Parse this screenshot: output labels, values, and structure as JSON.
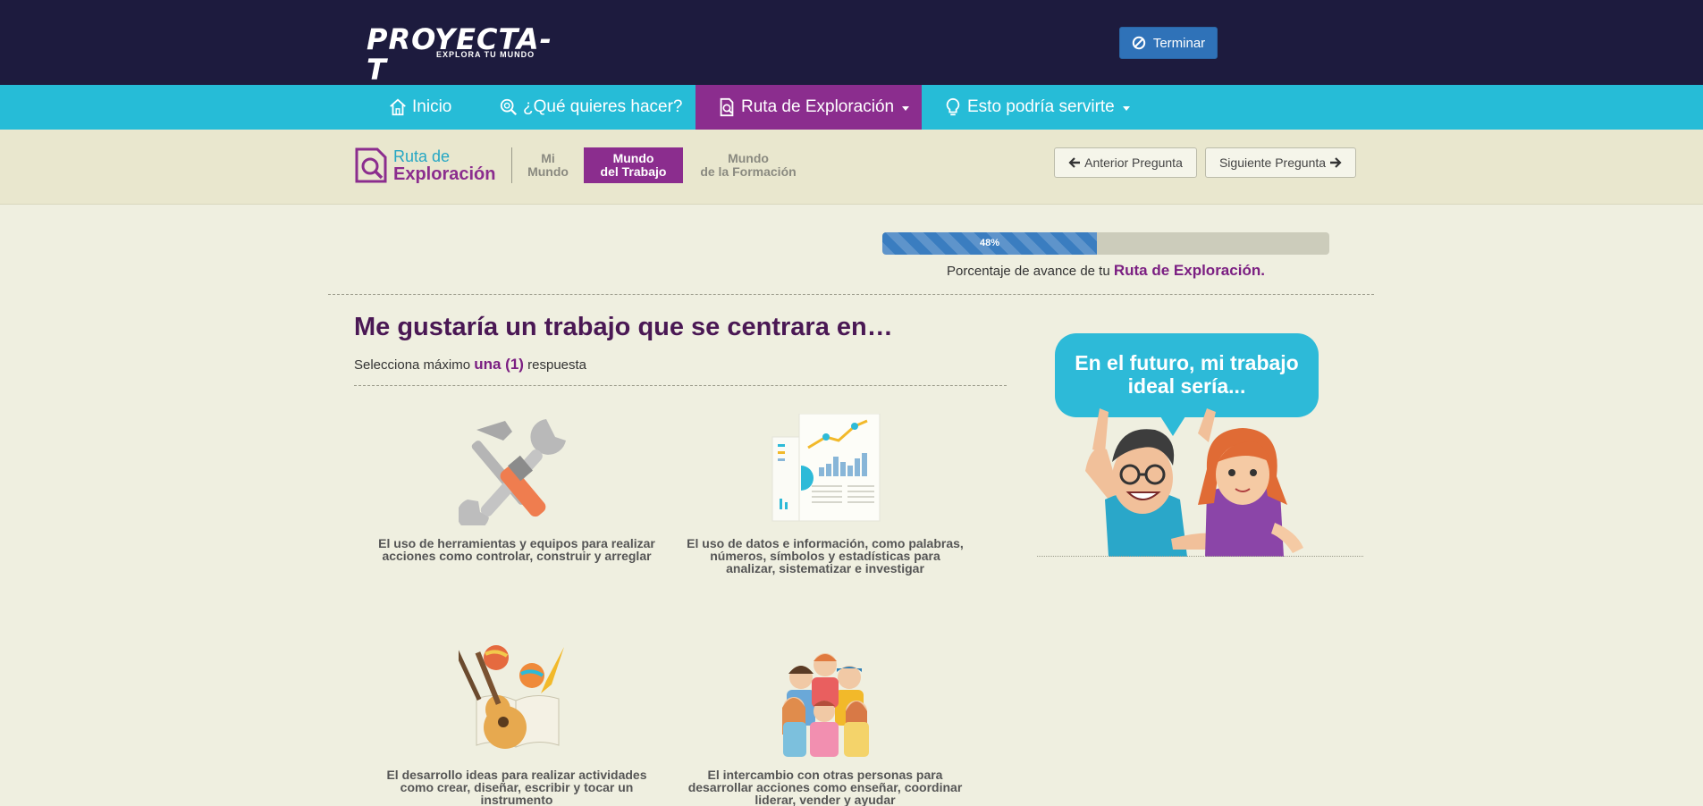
{
  "header": {
    "logo_main": "PROYECTA-T",
    "logo_sub": "EXPLORA TU MUNDO",
    "finish_label": "Terminar"
  },
  "nav": {
    "items": [
      {
        "label": "Inicio",
        "icon": "home-icon"
      },
      {
        "label": "¿Qué quieres hacer?",
        "icon": "search-icon"
      },
      {
        "label": "Ruta de Exploración",
        "icon": "document-search-icon",
        "active": true,
        "dropdown": true
      },
      {
        "label": "Esto podría servirte",
        "icon": "lightbulb-icon",
        "dropdown": true
      }
    ]
  },
  "subbar": {
    "ruta_line1": "Ruta de",
    "ruta_line2": "Exploración",
    "steps": [
      {
        "line1": "Mi",
        "line2": "Mundo"
      },
      {
        "line1": "Mundo",
        "line2": "del Trabajo",
        "active": true
      },
      {
        "line1": "Mundo",
        "line2": "de la Formación"
      }
    ],
    "prev_label": "Anterior Pregunta",
    "next_label": "Siguiente Pregunta"
  },
  "progress": {
    "value": 48,
    "label": "48%",
    "caption_prefix": "Porcentaje de avance de tu ",
    "caption_emphasis": "Ruta de Exploración."
  },
  "question": {
    "title": "Me gustaría un trabajo que se centrara en…",
    "sub_prefix": "Selecciona máximo ",
    "sub_emphasis": "una (1)",
    "sub_suffix": " respuesta",
    "options": [
      {
        "text": "El uso de herramientas y equipos para realizar acciones como controlar, construir y arreglar",
        "icon": "tools-icon"
      },
      {
        "text": "El uso de datos e información, como palabras, números, símbolos y estadísticas para analizar, sistematizar e investigar",
        "icon": "data-charts-icon"
      },
      {
        "text": "El desarrollo ideas para realizar actividades como crear, diseñar, escribir y tocar un instrumento",
        "icon": "art-music-icon"
      },
      {
        "text": "El intercambio con otras personas para desarrollar acciones como enseñar, coordinar liderar, vender y ayudar",
        "icon": "people-group-icon"
      }
    ]
  },
  "side": {
    "bubble_text": "En el futuro, mi trabajo ideal sería..."
  },
  "colors": {
    "header_bg": "#1d1b3e",
    "nav_bg": "#26bcd7",
    "accent_purple": "#8b2d8e",
    "progress_blue": "#3a7dc0",
    "page_bg": "#efefe0"
  }
}
